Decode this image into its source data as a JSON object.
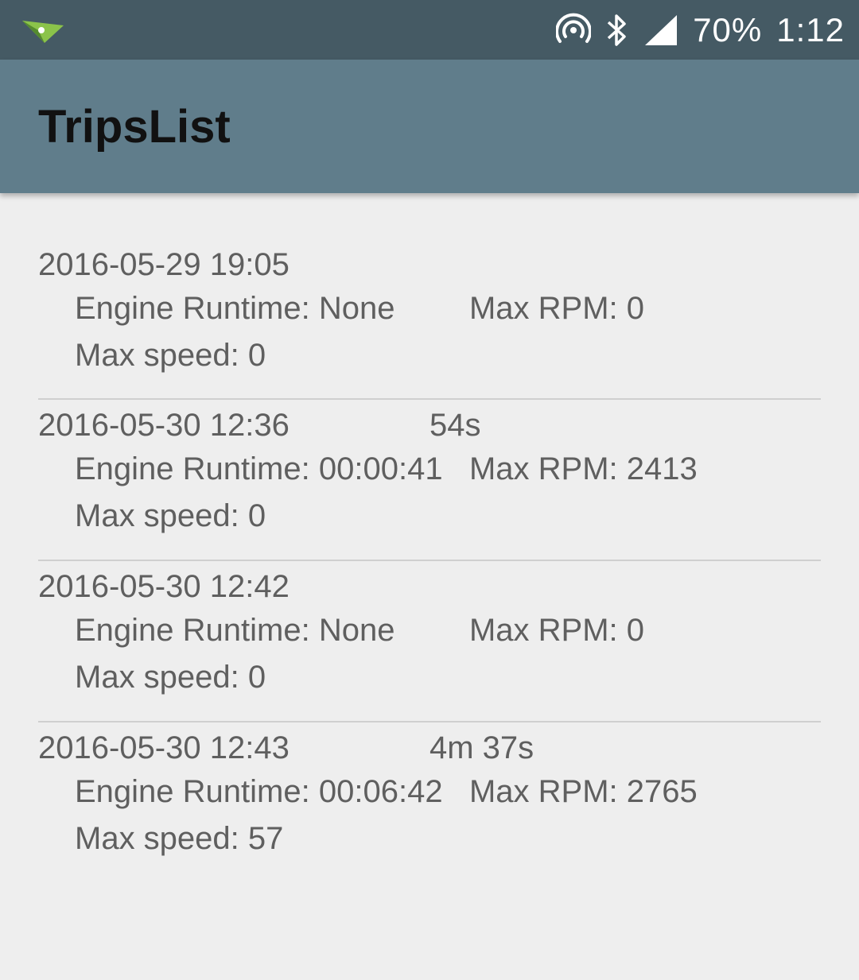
{
  "status_bar": {
    "notification_icon": "airdroid-plane-icon",
    "icons": [
      "hotspot-icon",
      "bluetooth-icon",
      "cell-signal-icon"
    ],
    "battery": "70%",
    "time": "1:12"
  },
  "app_bar": {
    "title": "TripsList"
  },
  "labels": {
    "engine_runtime": "Engine Runtime:",
    "max_rpm": "Max RPM:",
    "max_speed": "Max speed:"
  },
  "trips": [
    {
      "date": "2016-05-29 19:05",
      "duration": "",
      "engine_runtime": "None",
      "max_rpm": "0",
      "max_speed": "0"
    },
    {
      "date": "2016-05-30 12:36",
      "duration": "54s",
      "engine_runtime": "00:00:41",
      "max_rpm": "2413",
      "max_speed": "0"
    },
    {
      "date": "2016-05-30 12:42",
      "duration": "",
      "engine_runtime": "None",
      "max_rpm": "0",
      "max_speed": "0"
    },
    {
      "date": "2016-05-30 12:43",
      "duration": "4m 37s",
      "engine_runtime": "00:06:42",
      "max_rpm": "2765",
      "max_speed": "57"
    }
  ],
  "colors": {
    "status_bar": "#455a64",
    "app_bar": "#607d8b",
    "background": "#eeeeee",
    "text": "#5f5f5f",
    "divider": "#cfcfcf"
  }
}
